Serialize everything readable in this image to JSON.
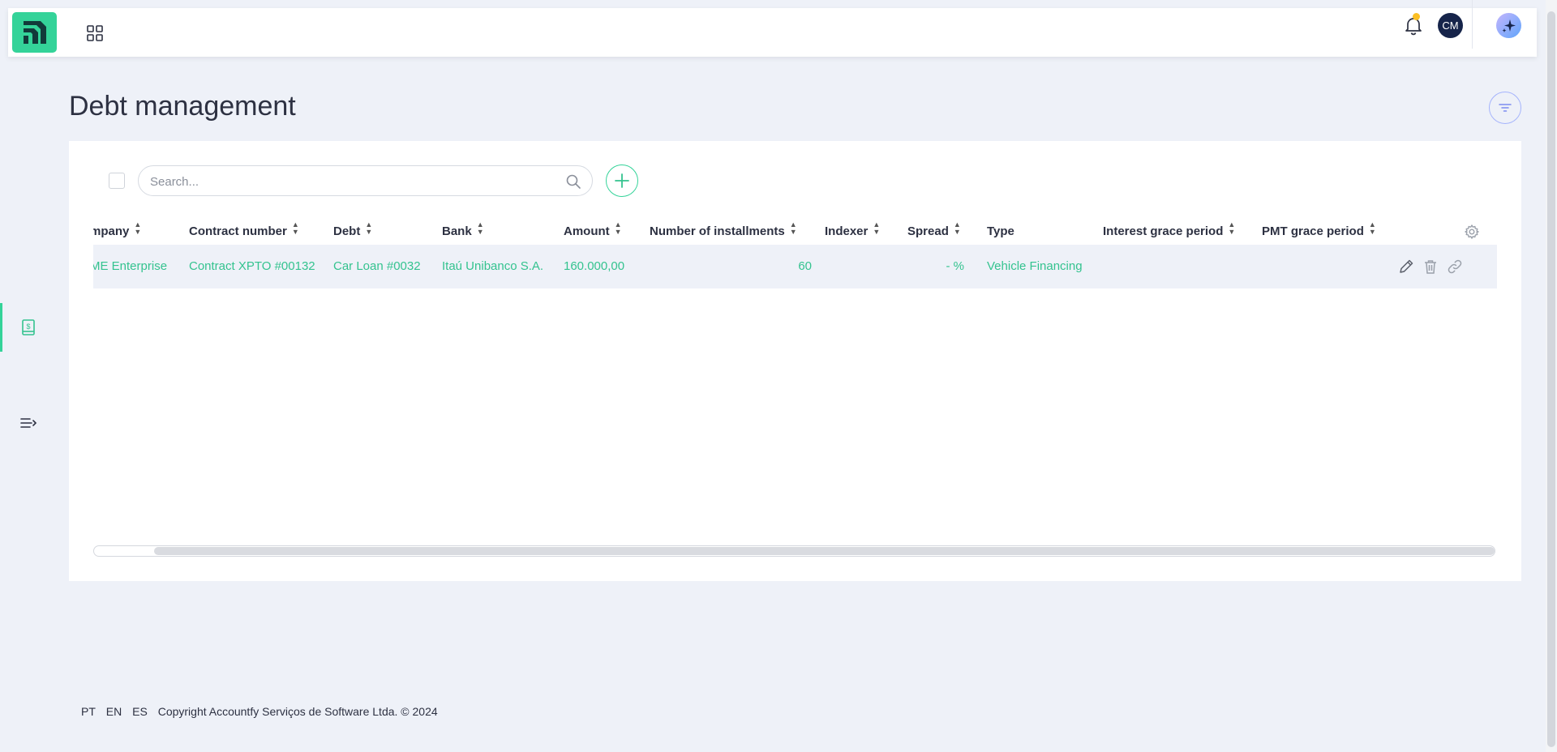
{
  "header": {
    "logo_icon": "accountfy-logo",
    "apps_icon": "grid-icon",
    "notifications_icon": "bell-icon",
    "avatar_initials": "CM",
    "assistant_icon": "sparkle-icon",
    "colors": {
      "brand": "#34d399",
      "accent_text": "#34c38f",
      "notification_dot": "#fbbf24"
    }
  },
  "sidebar": {
    "items": [
      {
        "icon": "debt-ledger-icon",
        "active": true
      },
      {
        "icon": "expand-menu-icon",
        "active": false
      }
    ]
  },
  "page": {
    "title": "Debt management",
    "filter_icon": "filter-icon"
  },
  "toolbar": {
    "search_placeholder": "Search...",
    "add_icon": "plus-icon"
  },
  "table": {
    "columns": [
      "mpany",
      "Contract number",
      "Debt",
      "Bank",
      "Amount",
      "Number of installments",
      "Indexer",
      "Spread",
      "Type",
      "Interest grace period",
      "PMT grace period"
    ],
    "rows": [
      {
        "company": "ME Enterprise",
        "contract_number": "Contract XPTO #00132",
        "debt": "Car Loan #0032",
        "bank": "Itaú Unibanco S.A.",
        "amount": "160.000,00",
        "installments": "60",
        "indexer": "",
        "spread": "- %",
        "type": "Vehicle Financing",
        "interest_grace_period": "",
        "pmt_grace_period": ""
      }
    ],
    "row_actions": [
      "edit-icon",
      "trash-icon",
      "link-icon"
    ],
    "settings_icon": "gear-icon",
    "horizontal_scroll_position": 0.044
  },
  "footer": {
    "languages": [
      "PT",
      "EN",
      "ES"
    ],
    "copyright": "Copyright Accountfy Serviços de Software Ltda. © 2024"
  }
}
